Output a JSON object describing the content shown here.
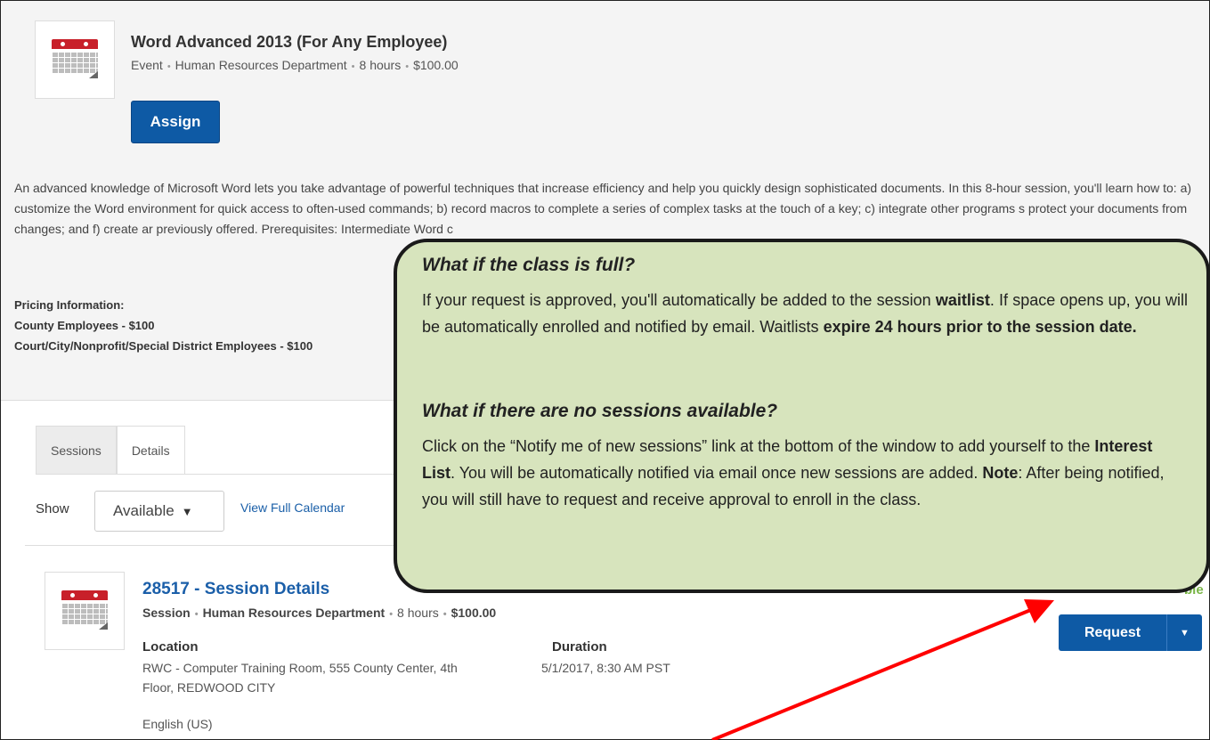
{
  "course": {
    "title": "Word Advanced 2013 (For Any Employee)",
    "meta": [
      "Event",
      "Human Resources Department",
      "8 hours",
      "$100.00"
    ],
    "assign_label": "Assign",
    "description": "An advanced knowledge of Microsoft Word lets you take advantage of powerful techniques that increase efficiency and help you quickly design sophisticated documents. In this 8-hour session, you'll learn how to: a) customize the Word environment for quick access to often-used commands; b) record macros to complete a series of complex tasks at the touch of a key; c) integrate other programs s protect your documents from changes; and f) create ar previously offered. Prerequisites: Intermediate Word c",
    "pricing": {
      "heading": "Pricing Information:",
      "lines": [
        "County Employees - $100",
        "Court/City/Nonprofit/Special District Employees - $100"
      ]
    }
  },
  "tabs": [
    {
      "label": "Sessions",
      "active": true
    },
    {
      "label": "Details",
      "active": false
    }
  ],
  "filter": {
    "show_label": "Show",
    "selected": "Available",
    "calendar_link": "View Full Calendar"
  },
  "session": {
    "title": "28517 - Session Details",
    "meta": [
      "Session",
      "Human Resources Department",
      "8 hours",
      "$100.00"
    ],
    "location_label": "Location",
    "location_line1": "RWC - Computer Training Room, 555 County Center, 4th",
    "location_line2": "Floor, REDWOOD CITY",
    "duration_label": "Duration",
    "duration_value": "5/1/2017, 8:30 AM PST",
    "language": "English (US)",
    "request_label": "Request",
    "availability": "ble"
  },
  "callout": {
    "q1": "What if the class is full?",
    "a1_parts": [
      "If your request is approved, you'll automatically be added to the session ",
      "waitlist",
      ". If space opens up, you will be automatically enrolled and notified by email. Waitlists ",
      "expire 24 hours prior to the session date."
    ],
    "q2": "What if there are no sessions available?",
    "a2_parts": [
      "Click on the “Notify me of new sessions” link at the bottom of the window to add yourself to the ",
      "Interest List",
      ". You will be automatically notified via email once new sessions are added. ",
      "Note",
      ": After being notified, you will still have to request and receive approval to enroll in the class."
    ]
  },
  "colors": {
    "primary_button": "#0e5aa5",
    "link": "#1b5fa9",
    "callout_bg": "#d7e4bd",
    "arrow": "#ff0000",
    "calendar_red": "#c8202a"
  },
  "icons": [
    "calendar-icon",
    "caret-down-icon",
    "red-arrow-annotation"
  ]
}
